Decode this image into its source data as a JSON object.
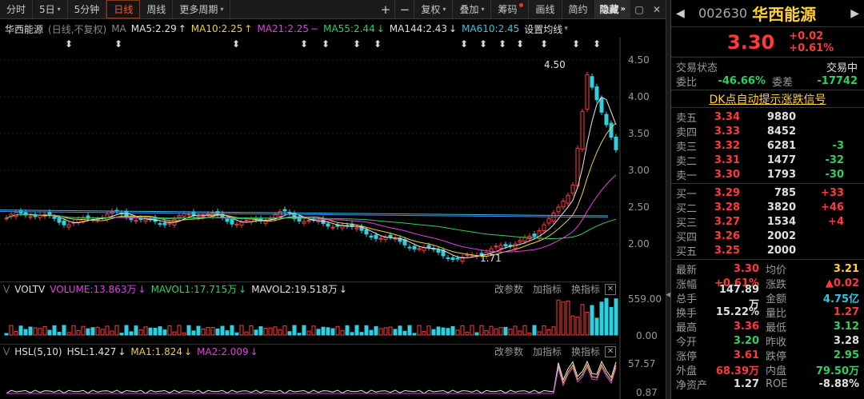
{
  "toolbar": {
    "items": [
      "分时",
      "5日",
      "5分钟",
      "日线",
      "周线",
      "更多周期",
      "复权",
      "叠加",
      "筹码",
      "画线",
      "简约"
    ],
    "fiveday_arrow": "▾",
    "more_arrow": "▾",
    "fq_arrow": "▾",
    "overlay_arrow": "▾",
    "plus": "+",
    "minus": "−",
    "hide": "隐藏",
    "hide_arrow": "»",
    "win_a": "▢",
    "win_b": "✕"
  },
  "main_header": {
    "name": "华西能源",
    "period": "(日线,不复权)",
    "ma": "MA",
    "ma5": "MA5:2.29",
    "ma5_dir": "↑",
    "ma10": "MA10:2.25",
    "ma10_dir": "↑",
    "ma21": "MA21:2.25",
    "ma21_dir": "−",
    "ma55": "MA55:2.44",
    "ma55_dir": "↓",
    "ma144": "MA144:2.43",
    "ma144_dir": "↓",
    "ma610": "MA610:2.45",
    "setting": "设置均线",
    "setting_arrow": "▾"
  },
  "price_axis": [
    "4.50",
    "4.00",
    "3.50",
    "3.00",
    "2.50",
    "2.00"
  ],
  "annotations": {
    "high": "4.50",
    "low": "1.71"
  },
  "volume_header": {
    "label": "VOLTV",
    "volume": "VOLUME:13.863万",
    "volume_dir": "↓",
    "mavol1": "MAVOL1:17.715万",
    "mavol1_dir": "↓",
    "mavol2": "MAVOL2:19.518万",
    "mavol2_dir": "↓",
    "btn1": "改参数",
    "btn2": "加指标",
    "btn3": "换指标",
    "close": "✕"
  },
  "volume_axis": [
    "559.00",
    "0.00"
  ],
  "hsl_header": {
    "label": "HSL(5,10)",
    "hsl": "HSL:1.427",
    "hsl_dir": "↓",
    "ma1": "MA1:1.824",
    "ma1_dir": "↓",
    "ma2": "MA2:2.009",
    "ma2_dir": "↓",
    "btn1": "改参数",
    "btn2": "加指标",
    "btn3": "换指标",
    "close": "✕"
  },
  "hsl_axis": [
    "57.57",
    "0.87"
  ],
  "quote": {
    "nav_left": "◀",
    "nav_right": "▶",
    "code": "002630",
    "name": "华西能源",
    "price": "3.30",
    "change": "+0.02",
    "change_pct": "+0.61%",
    "status_label": "交易状态",
    "status": "交易中",
    "weibi_label": "委比",
    "weibi": "-46.66%",
    "weicha_label": "委差",
    "weicha": "-17742",
    "dk_label": "DK点自动提示涨跌信号",
    "asks": [
      {
        "label": "卖五",
        "price": "3.34",
        "vol": "9880",
        "chg": ""
      },
      {
        "label": "卖四",
        "price": "3.33",
        "vol": "8452",
        "chg": ""
      },
      {
        "label": "卖三",
        "price": "3.32",
        "vol": "6281",
        "chg": "-3"
      },
      {
        "label": "卖二",
        "price": "3.31",
        "vol": "1477",
        "chg": "-32"
      },
      {
        "label": "卖一",
        "price": "3.30",
        "vol": "1793",
        "chg": "-30"
      }
    ],
    "bids": [
      {
        "label": "买一",
        "price": "3.29",
        "vol": "785",
        "chg": "+33"
      },
      {
        "label": "买二",
        "price": "3.28",
        "vol": "3820",
        "chg": "+46"
      },
      {
        "label": "买三",
        "price": "3.27",
        "vol": "1534",
        "chg": "+4"
      },
      {
        "label": "买四",
        "price": "3.26",
        "vol": "2002",
        "chg": ""
      },
      {
        "label": "买五",
        "price": "3.25",
        "vol": "2000",
        "chg": ""
      }
    ],
    "stats": [
      {
        "l1": "最新",
        "v1": "3.30",
        "c1": "red",
        "l2": "均价",
        "v2": "3.21",
        "c2": "yel"
      },
      {
        "l1": "涨幅",
        "v1": "+0.61%",
        "c1": "red",
        "l2": "涨跌",
        "v2": "▲0.02",
        "c2": "red"
      },
      {
        "l1": "总手",
        "v1": "147.89万",
        "c1": "white",
        "l2": "金额",
        "v2": "4.75亿",
        "c2": "cyan"
      },
      {
        "l1": "换手",
        "v1": "15.22%",
        "c1": "white",
        "l2": "量比",
        "v2": "1.27",
        "c2": "red"
      },
      {
        "l1": "最高",
        "v1": "3.36",
        "c1": "red",
        "l2": "最低",
        "v2": "3.12",
        "c2": "green"
      },
      {
        "l1": "今开",
        "v1": "3.20",
        "c1": "green",
        "l2": "昨收",
        "v2": "3.28",
        "c2": "white"
      },
      {
        "l1": "涨停",
        "v1": "3.61",
        "c1": "red",
        "l2": "跌停",
        "v2": "2.95",
        "c2": "green"
      },
      {
        "l1": "外盘",
        "v1": "68.39万",
        "c1": "red",
        "l2": "内盘",
        "v2": "79.50万",
        "c2": "green"
      },
      {
        "l1": "净资产",
        "v1": "1.27",
        "c1": "white",
        "l2": "ROE",
        "v2": "-8.88%",
        "c2": "white"
      }
    ]
  },
  "colors": {
    "up": "#ff3a3a",
    "down": "#30d0e0",
    "ma5": "#e8e8e8",
    "ma10": "#e8d23a",
    "ma21": "#e040e0",
    "ma55": "#30d060",
    "ma144": "#5080ff",
    "ma610": "#30c8e0"
  }
}
